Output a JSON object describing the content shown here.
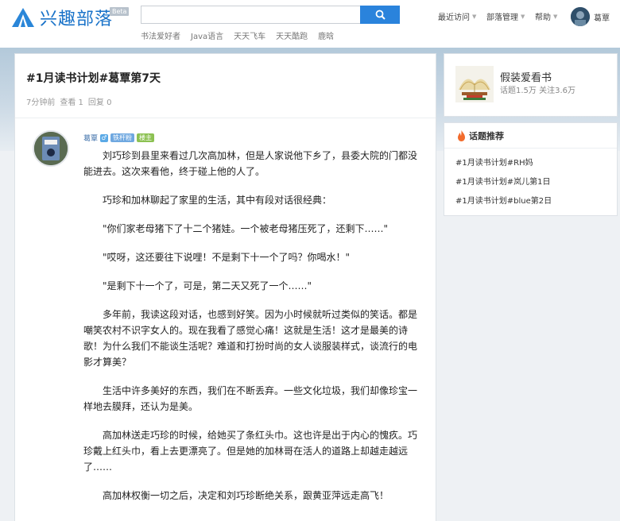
{
  "header": {
    "logo_text": "兴趣部落",
    "beta": "Beta",
    "search_placeholder": "",
    "hot_tags": [
      "书法爱好者",
      "Java语言",
      "天天飞车",
      "天天酷跑",
      "鹿晗"
    ],
    "nav": {
      "recent": "最近访问",
      "manage": "部落管理",
      "help": "帮助"
    },
    "username": "葛覃",
    "brand_color": "#1a73c9"
  },
  "post": {
    "title": "#1月读书计划#葛覃第7天",
    "meta": {
      "time": "7分钟前",
      "views": "查看 1",
      "replies": "回复 0"
    },
    "author": {
      "name": "葛覃",
      "gender": "♂",
      "badge_level": "铁杆粉",
      "badge_role": "楼主"
    },
    "paragraphs": [
      "刘巧珍到县里来看过几次高加林，但是人家说他下乡了，县委大院的门都没能进去。这次来看他，终于碰上他的人了。",
      "巧珍和加林聊起了家里的生活，其中有段对话很经典：",
      "\"你们家老母猪下了十二个猪娃。一个被老母猪压死了，还剩下……\"",
      "\"哎呀，这还要往下说哩！不是剩下十一个了吗？你喝水！\"",
      "\"是剩下十一个了，可是，第二天又死了一个……\"",
      "多年前，我读这段对话，也感到好笑。因为小时候就听过类似的笑话。都是嘲笑农村不识字女人的。现在我看了感觉心痛！这就是生活！这才是最美的诗歌！为什么我们不能谈生活呢？难道和打扮时尚的女人谈服装样式，谈流行的电影才算美？",
      "生活中许多美好的东西，我们在不断丢弃。一些文化垃圾，我们却像珍宝一样地去膜拜，还认为是美。",
      "高加林送走巧珍的时候，给她买了条红头巾。这也许是出于内心的愧疚。巧珍戴上红头巾，看上去更漂亮了。但是她的加林哥在活人的道路上却越走越远了……",
      "高加林权衡一切之后，决定和刘巧珍断绝关系，跟黄亚萍远走高飞！"
    ]
  },
  "sidebar": {
    "group": {
      "name": "假装爱看书",
      "stats": "话题1.5万 关注3.6万"
    },
    "topics": {
      "heading": "话题推荐",
      "items": [
        "#1月读书计划#RH妈",
        "#1月读书计划#岚儿第1日",
        "#1月读书计划#blue第2日"
      ]
    }
  }
}
